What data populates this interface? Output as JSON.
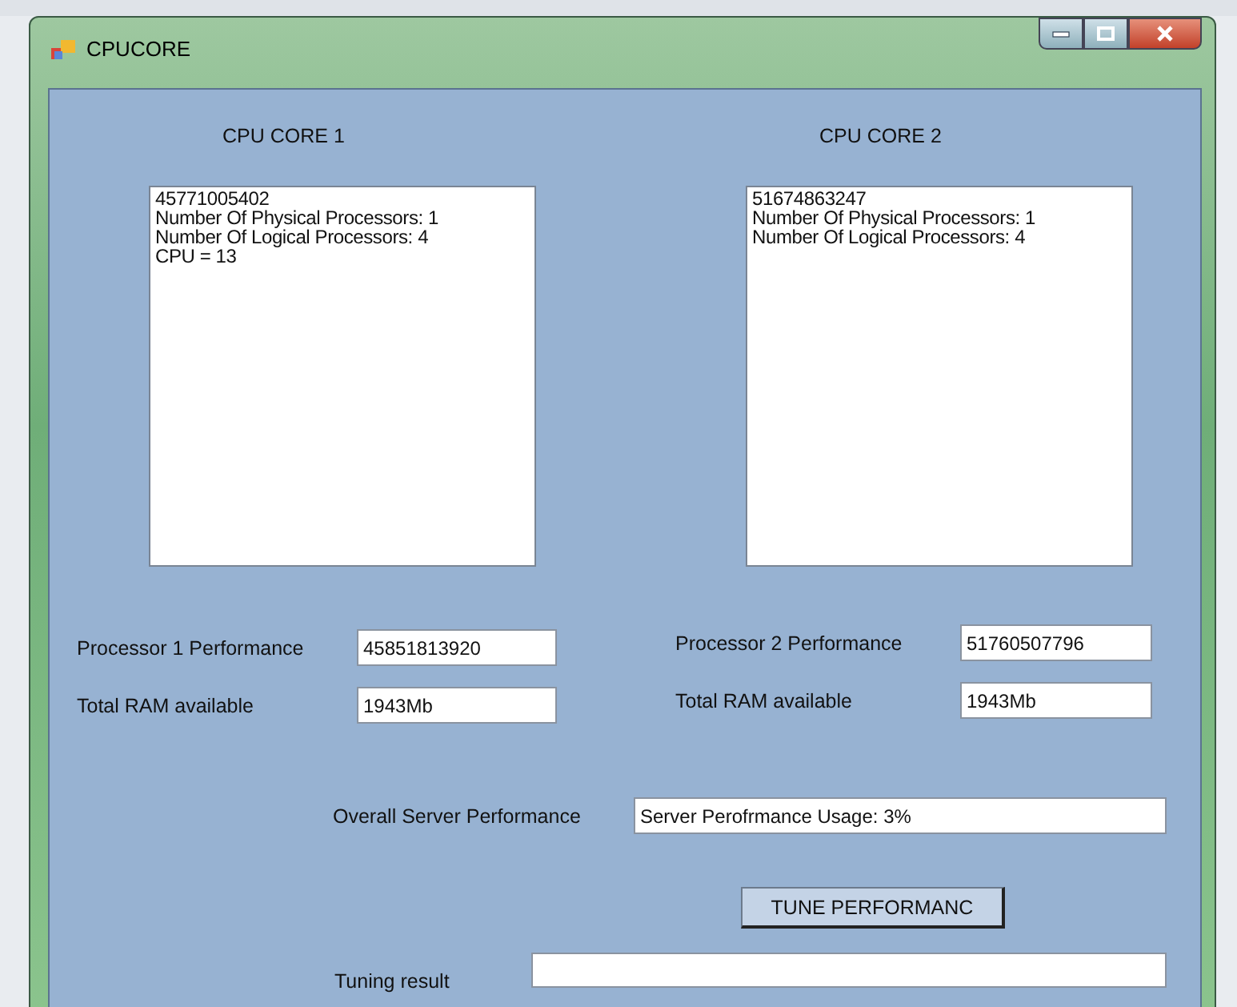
{
  "window": {
    "title": "CPUCORE"
  },
  "cores": [
    {
      "heading": "CPU CORE 1",
      "lines": [
        "45771005402",
        "Number Of Physical Processors: 1",
        "Number Of Logical Processors: 4",
        "CPU = 13"
      ],
      "performance_label": "Processor 1 Performance",
      "performance": "45851813920",
      "ram_label": "Total RAM available",
      "ram": "1943Mb"
    },
    {
      "heading": "CPU CORE 2",
      "lines": [
        "51674863247",
        "Number Of Physical Processors: 1",
        "Number Of Logical Processors: 4"
      ],
      "performance_label": "Processor 2 Performance",
      "performance": "51760507796",
      "ram_label": "Total RAM available",
      "ram": "1943Mb"
    }
  ],
  "overall": {
    "label": "Overall Server Performance",
    "value": "Server Perofrmance Usage: 3%"
  },
  "tune_button": "TUNE PERFORMANC",
  "tuning": {
    "label": "Tuning result"
  }
}
